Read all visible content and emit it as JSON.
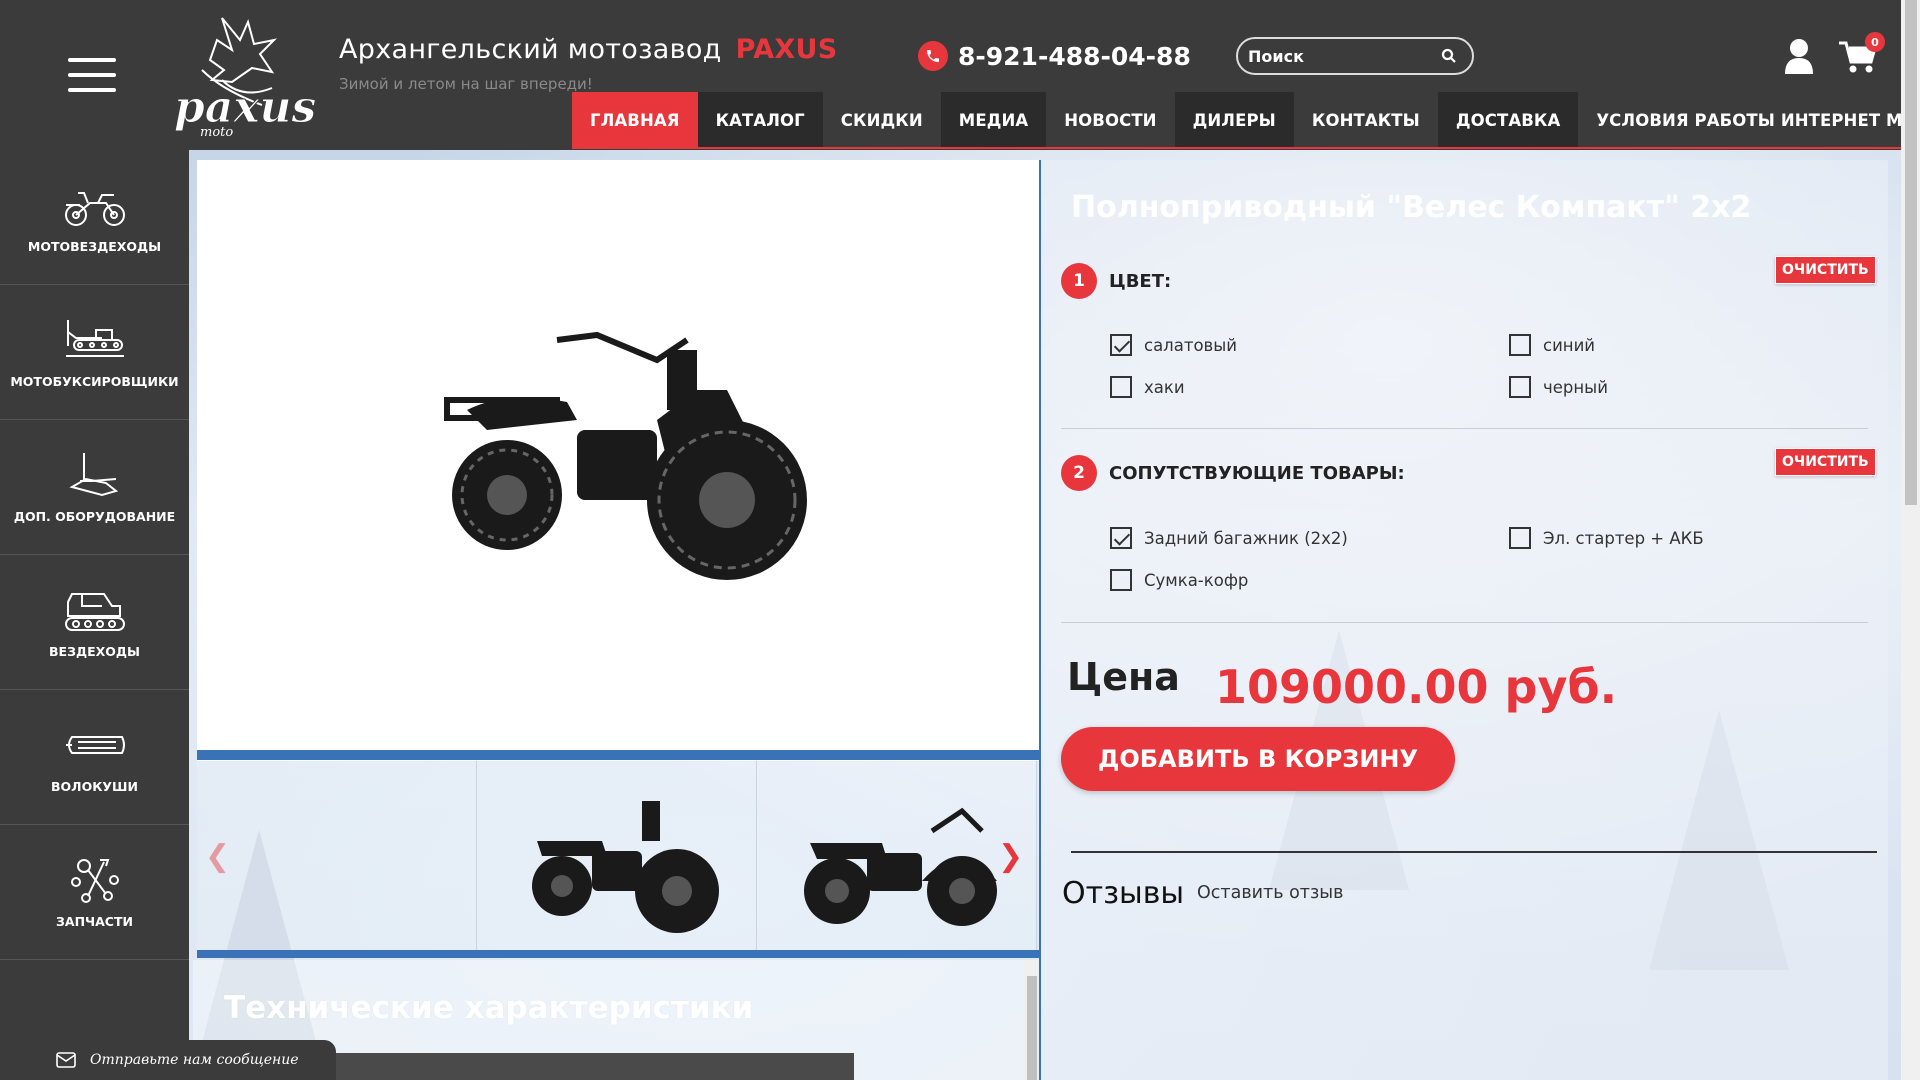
{
  "header": {
    "brand_title": "Архангельский мотозавод",
    "brand_accent": "PAXUS",
    "tagline": "Зимой и летом на шаг впереди!",
    "phone": "8-921-488-04-88",
    "search_placeholder": "Поиск",
    "cart_count": "0",
    "logo_text": "paxus",
    "logo_subtext": "moto"
  },
  "nav": [
    {
      "label": "ГЛАВНАЯ",
      "active": true
    },
    {
      "label": "КАТАЛОГ"
    },
    {
      "label": "СКИДКИ"
    },
    {
      "label": "МЕДИА"
    },
    {
      "label": "НОВОСТИ"
    },
    {
      "label": "ДИЛЕРЫ"
    },
    {
      "label": "КОНТАКТЫ"
    },
    {
      "label": "ДОСТАВКА"
    },
    {
      "label": "УСЛОВИЯ РАБОТЫ ИНТЕРНЕТ МАГАЗИНА"
    }
  ],
  "sidebar": {
    "items": [
      {
        "label": "МОТОВЕЗДЕХОДЫ",
        "icon": "atv-icon"
      },
      {
        "label": "МОТОБУКСИРОВЩИКИ",
        "icon": "snow-tow-icon"
      },
      {
        "label": "ДОП. ОБОРУДОВАНИЕ",
        "icon": "equipment-icon"
      },
      {
        "label": "ВЕЗДЕХОДЫ",
        "icon": "tracked-vehicle-icon"
      },
      {
        "label": "ВОЛОКУШИ",
        "icon": "sled-icon"
      },
      {
        "label": "ЗАПЧАСТИ",
        "icon": "parts-icon"
      }
    ]
  },
  "product": {
    "title": "Полноприводный \"Велес Компакт\" 2x2",
    "step1": {
      "number": "1",
      "label": "ЦВЕТ:",
      "clear": "ОЧИСТИТЬ",
      "options": [
        {
          "label": "салатовый",
          "checked": true
        },
        {
          "label": "синий",
          "checked": false
        },
        {
          "label": "хаки",
          "checked": false
        },
        {
          "label": "черный",
          "checked": false
        }
      ]
    },
    "step2": {
      "number": "2",
      "label": "СОПУТСТВУЮЩИЕ ТОВАРЫ:",
      "clear": "ОЧИСТИТЬ",
      "options": [
        {
          "label": "Задний багажник (2x2)",
          "checked": true
        },
        {
          "label": "Эл. стартер + АКБ",
          "checked": false
        },
        {
          "label": "Сумка-кофр",
          "checked": false
        }
      ]
    },
    "price_label": "Цена",
    "price_value": "109000.00 руб.",
    "add_to_cart": "ДОБАВИТЬ В КОРЗИНУ"
  },
  "reviews": {
    "title": "Отзывы",
    "leave_review": "Оставить отзыв"
  },
  "tech": {
    "title": "Технические характеристики"
  },
  "chat": {
    "label": "Отправьте нам сообщение"
  },
  "colors": {
    "accent": "#e8373c",
    "header_bg": "#3b3b3b",
    "gallery_blue": "#3a72b7"
  }
}
